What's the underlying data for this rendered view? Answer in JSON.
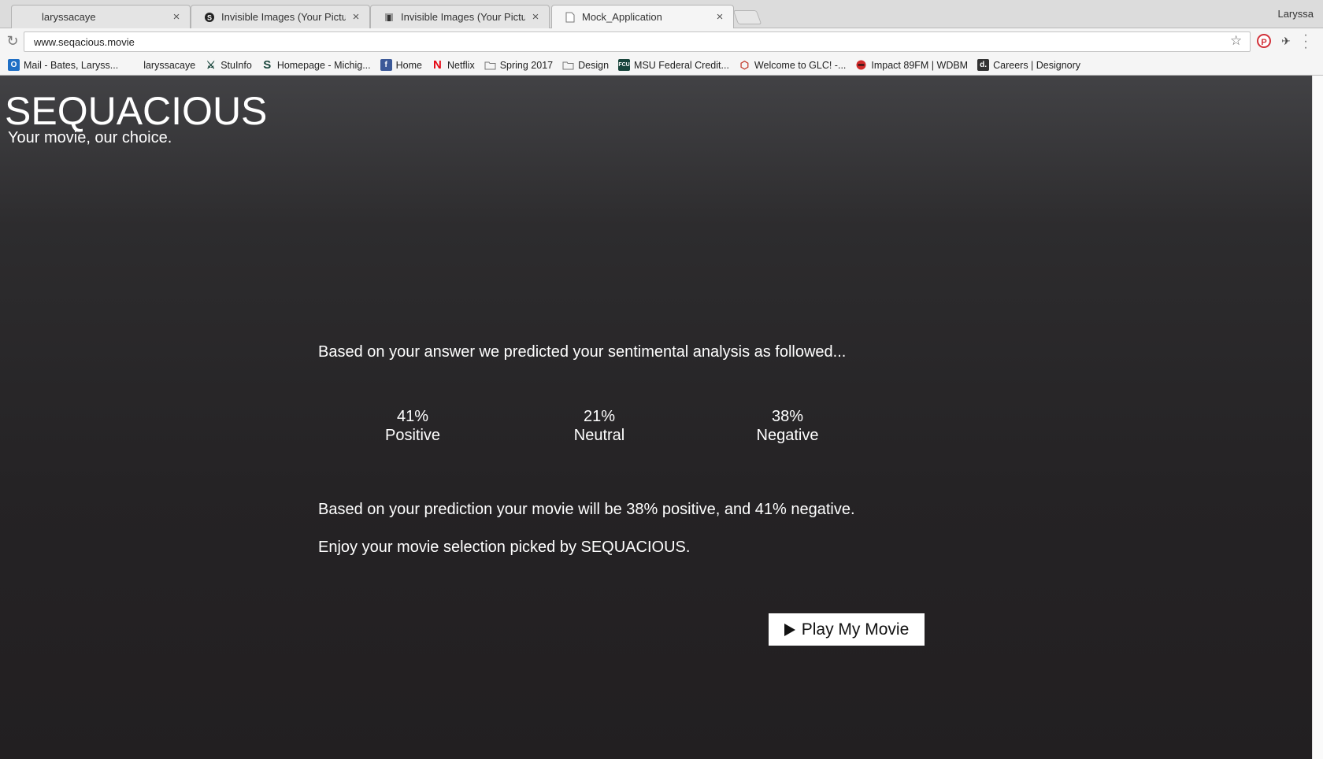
{
  "browser": {
    "tabs": [
      {
        "title": "laryssacaye",
        "icon": "blank-icon",
        "active": false
      },
      {
        "title": "Invisible Images (Your Pictures",
        "icon": "sound-s-icon",
        "active": false
      },
      {
        "title": "Invisible Images (Your Pictures",
        "icon": "statue-icon",
        "active": false
      },
      {
        "title": "Mock_Application",
        "icon": "document-icon",
        "active": true
      }
    ],
    "profile_name": "Laryssa",
    "url": "www.seqacious.movie",
    "bookmarks": [
      {
        "label": "Mail - Bates, Laryss...",
        "icon": "outlook-icon",
        "color": "#1f6fc5"
      },
      {
        "label": "laryssacaye",
        "icon": "blank-icon",
        "color": "#f5f5f5"
      },
      {
        "label": "StuInfo",
        "icon": "spartan-icon",
        "color": "#18453b"
      },
      {
        "label": "Homepage - Michig...",
        "icon": "s-logo-icon",
        "color": "#18453b"
      },
      {
        "label": "Home",
        "icon": "facebook-icon",
        "color": "#3b5998"
      },
      {
        "label": "Netflix",
        "icon": "netflix-icon",
        "color": "#e50914"
      },
      {
        "label": "Spring 2017",
        "icon": "folder-icon",
        "color": "#888888"
      },
      {
        "label": "Design",
        "icon": "folder-icon",
        "color": "#888888"
      },
      {
        "label": "MSU Federal Credit...",
        "icon": "msufcu-icon",
        "color": "#18453b"
      },
      {
        "label": "Welcome to GLC! -...",
        "icon": "glc-icon",
        "color": "#c23a2b"
      },
      {
        "label": "Impact 89FM | WDBM",
        "icon": "impact-icon",
        "color": "#d22b2b"
      },
      {
        "label": "Careers | Designory",
        "icon": "designory-icon",
        "color": "#333333"
      }
    ]
  },
  "site": {
    "brand": "SEQUACIOUS",
    "tagline": "Your movie, our choice."
  },
  "analysis": {
    "lead": "Based on your answer we predicted your sentimental analysis as followed...",
    "stats": [
      {
        "percent": "41%",
        "label": "Positive"
      },
      {
        "percent": "21%",
        "label": "Neutral"
      },
      {
        "percent": "38%",
        "label": "Negative"
      }
    ],
    "result": "Based on your prediction your movie will be 38% positive, and 41% negative.",
    "enjoy": "Enjoy your movie selection picked by SEQUACIOUS.",
    "play_label": "Play My Movie"
  }
}
